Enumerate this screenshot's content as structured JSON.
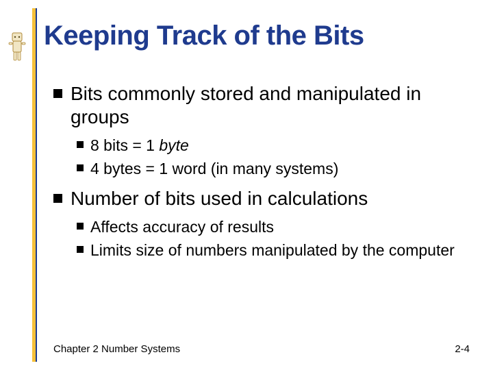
{
  "title": "Keeping Track of the Bits",
  "bullets": {
    "b1": {
      "text": "Bits commonly stored and manipulated in groups",
      "sub": {
        "s1_pre": "8 bits = 1 ",
        "s1_em": "byte",
        "s2": "4 bytes = 1 word (in many systems)"
      }
    },
    "b2": {
      "text": "Number of bits used in calculations",
      "sub": {
        "s1": "Affects accuracy of results",
        "s2": "Limits size of numbers manipulated by the computer"
      }
    }
  },
  "footer": {
    "left": "Chapter 2 Number Systems",
    "right": "2-4"
  }
}
